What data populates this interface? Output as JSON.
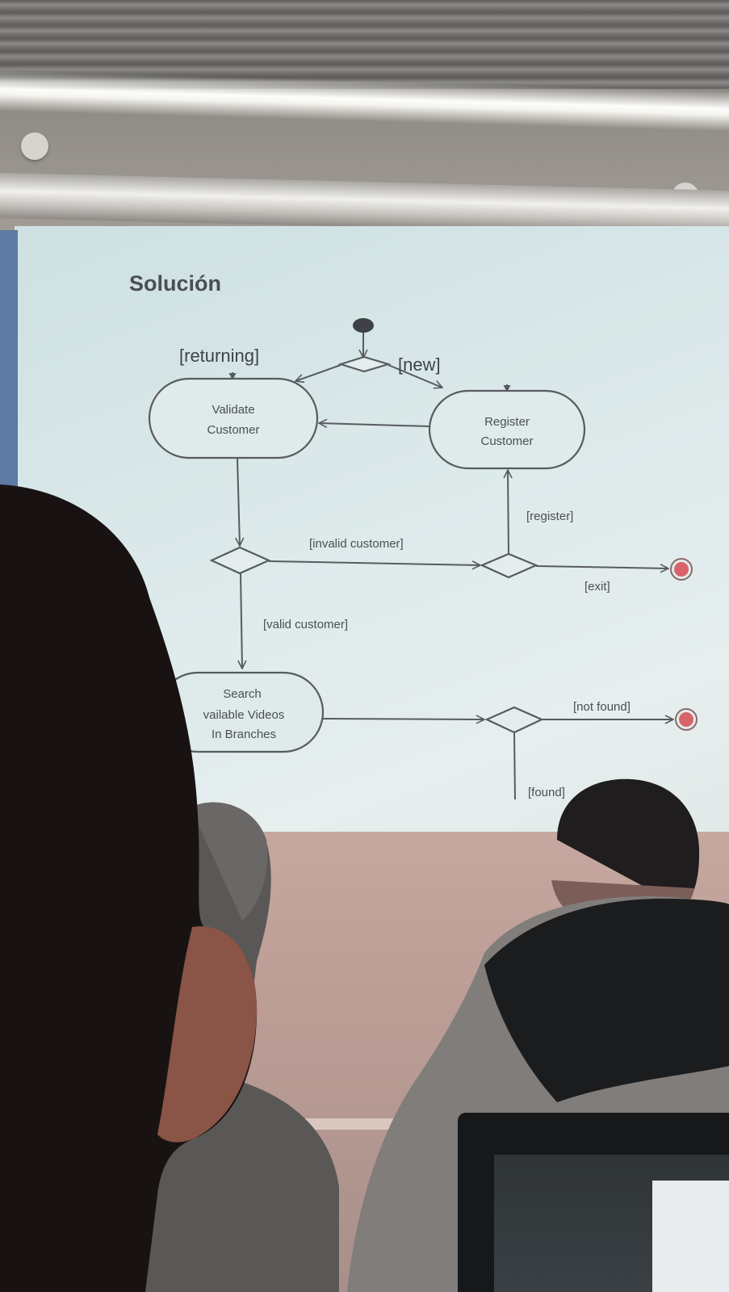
{
  "slide": {
    "title": "Solución"
  },
  "nodes": {
    "validate": [
      "Validate",
      "Customer"
    ],
    "register": [
      "Register",
      "Customer"
    ],
    "search": [
      "Search",
      "vailable  Videos",
      "In Branches"
    ]
  },
  "guards": {
    "returning": "[returning]",
    "new": "[new]",
    "invalid_customer": "[invalid customer]",
    "register": "[register]",
    "exit": "[exit]",
    "valid_customer": "[valid customer]",
    "not_found": "[not found]",
    "found": "[found]"
  },
  "colors": {
    "screen": "#dce9ea",
    "line": "#575b60",
    "final_node": "#d8646a",
    "wall": "#bb9d95"
  }
}
